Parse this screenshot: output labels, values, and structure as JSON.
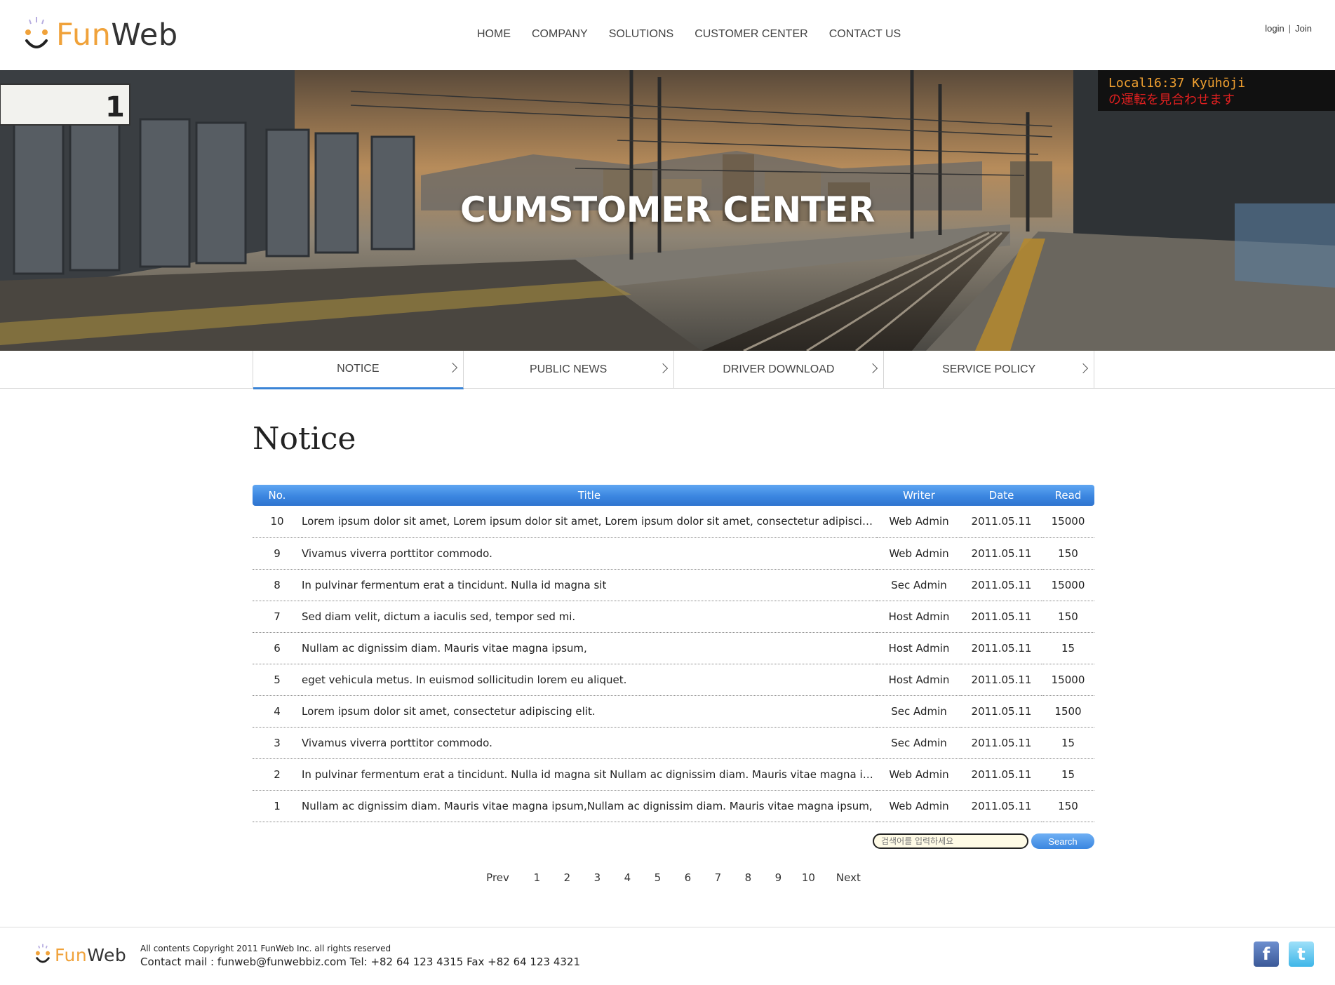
{
  "header": {
    "logo": {
      "fun": "Fun",
      "web": "Web"
    },
    "nav": [
      {
        "label": "HOME"
      },
      {
        "label": "COMPANY"
      },
      {
        "label": "SOLUTIONS"
      },
      {
        "label": "CUSTOMER CENTER"
      },
      {
        "label": "CONTACT US"
      }
    ],
    "auth": {
      "login": "login",
      "separator": "|",
      "join": "Join"
    }
  },
  "hero": {
    "title": "CUMSTOMER CENTER",
    "sign_text": "Local16:37 Kyūhōji",
    "sign_text2": "の運転を見合わせます",
    "platform_number": "1"
  },
  "subtabs": [
    {
      "label": "NOTICE",
      "active": true
    },
    {
      "label": "PUBLIC NEWS",
      "active": false
    },
    {
      "label": "DRIVER DOWNLOAD",
      "active": false
    },
    {
      "label": "SERVICE POLICY",
      "active": false
    }
  ],
  "page_title": "Notice",
  "table": {
    "headers": {
      "no": "No.",
      "title": "Title",
      "writer": "Writer",
      "date": "Date",
      "read": "Read"
    },
    "rows": [
      {
        "no": "10",
        "title": "Lorem ipsum dolor sit amet, Lorem ipsum dolor sit amet, Lorem ipsum dolor sit amet, consectetur adipiscing elit...",
        "writer": "Web Admin",
        "date": "2011.05.11",
        "read": "15000"
      },
      {
        "no": "9",
        "title": "Vivamus viverra porttitor commodo.",
        "writer": "Web Admin",
        "date": "2011.05.11",
        "read": "150"
      },
      {
        "no": "8",
        "title": "In pulvinar fermentum erat a tincidunt. Nulla id magna sit",
        "writer": "Sec Admin",
        "date": "2011.05.11",
        "read": "15000"
      },
      {
        "no": "7",
        "title": "Sed diam velit, dictum a iaculis sed, tempor sed mi.",
        "writer": "Host Admin",
        "date": "2011.05.11",
        "read": "150"
      },
      {
        "no": "6",
        "title": "Nullam ac dignissim diam. Mauris vitae magna ipsum,",
        "writer": "Host Admin",
        "date": "2011.05.11",
        "read": "15"
      },
      {
        "no": "5",
        "title": "eget vehicula metus. In euismod sollicitudin lorem eu aliquet.",
        "writer": "Host Admin",
        "date": "2011.05.11",
        "read": "15000"
      },
      {
        "no": "4",
        "title": "Lorem ipsum dolor sit amet, consectetur adipiscing elit.",
        "writer": "Sec Admin",
        "date": "2011.05.11",
        "read": "1500"
      },
      {
        "no": "3",
        "title": "Vivamus viverra porttitor commodo.",
        "writer": "Sec Admin",
        "date": "2011.05.11",
        "read": "15"
      },
      {
        "no": "2",
        "title": "In pulvinar fermentum erat a tincidunt. Nulla id magna sit Nullam ac dignissim diam. Mauris vitae magna ipsum,",
        "writer": "Web Admin",
        "date": "2011.05.11",
        "read": "15"
      },
      {
        "no": "1",
        "title": "Nullam ac dignissim diam. Mauris vitae magna ipsum,Nullam ac dignissim diam. Mauris vitae magna ipsum,",
        "writer": "Web Admin",
        "date": "2011.05.11",
        "read": "150"
      }
    ]
  },
  "search": {
    "placeholder": "검색어를 입력하세요",
    "button": "Search"
  },
  "paging": {
    "prev": "Prev",
    "pages": [
      "1",
      "2",
      "3",
      "4",
      "5",
      "6",
      "7",
      "8",
      "9",
      "10"
    ],
    "next": "Next"
  },
  "footer": {
    "logo": {
      "fun": "Fun",
      "web": "Web"
    },
    "copyright": "All contents Copyright 2011 FunWeb Inc. all rights reserved",
    "contact": "Contact mail : funweb@funwebbiz.com Tel: +82 64 123 4315 Fax +82 64 123 4321",
    "social": [
      {
        "icon": "facebook-icon",
        "glyph": "f"
      },
      {
        "icon": "twitter-icon",
        "glyph": "t"
      }
    ]
  },
  "colors": {
    "accent": "#3a84d6",
    "brand_orange": "#f0a23a"
  }
}
